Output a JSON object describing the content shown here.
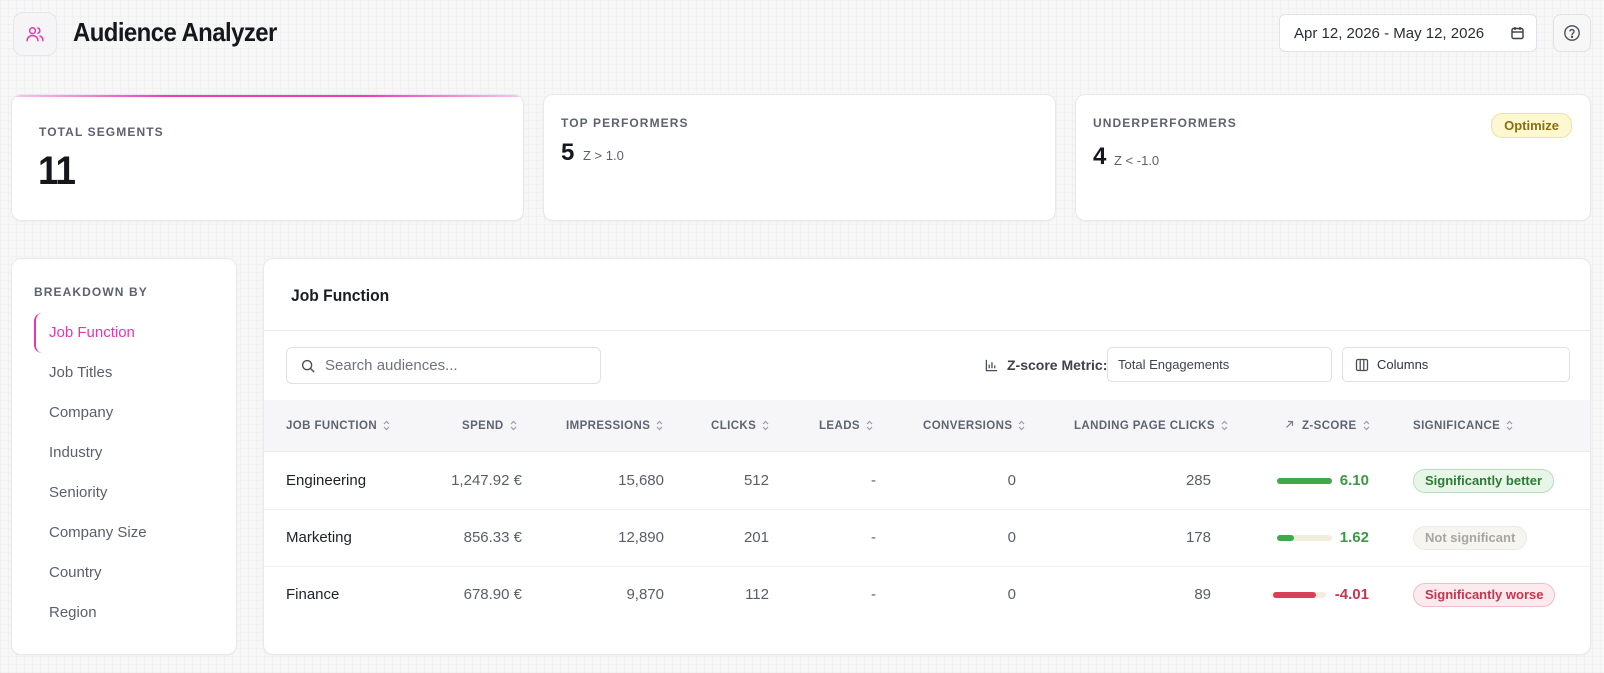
{
  "header": {
    "title": "Audience Analyzer",
    "date_range": "Apr 12, 2026 - May 12, 2026"
  },
  "stats": {
    "total_segments": {
      "label": "TOTAL SEGMENTS",
      "value": "11"
    },
    "top_performers": {
      "label": "TOP PERFORMERS",
      "value": "5",
      "note": "Z > 1.0"
    },
    "underperformers": {
      "label": "UNDERPERFORMERS",
      "value": "4",
      "note": "Z < -1.0",
      "badge": "Optimize"
    }
  },
  "sidebar": {
    "title": "BREAKDOWN BY",
    "items": [
      {
        "label": "Job Function"
      },
      {
        "label": "Job Titles"
      },
      {
        "label": "Company"
      },
      {
        "label": "Industry"
      },
      {
        "label": "Seniority"
      },
      {
        "label": "Company Size"
      },
      {
        "label": "Country"
      },
      {
        "label": "Region"
      }
    ],
    "active_index": 0
  },
  "panel": {
    "title": "Job Function",
    "search_placeholder": "Search audiences...",
    "zscore_metric_label": "Z-score Metric:",
    "zscore_metric_value": "Total Engagements",
    "columns_label": "Columns"
  },
  "table": {
    "headers": {
      "job_function": "JOB FUNCTION",
      "spend": "SPEND",
      "impressions": "IMPRESSIONS",
      "clicks": "CLICKS",
      "leads": "LEADS",
      "conversions": "CONVERSIONS",
      "landing_page_clicks": "LANDING PAGE CLICKS",
      "zscore": "Z-SCORE",
      "significance": "SIGNIFICANCE"
    },
    "rows": [
      {
        "name": "Engineering",
        "spend": "1,247.92 €",
        "impressions": "15,680",
        "clicks": "512",
        "leads": "-",
        "conversions": "0",
        "lp_clicks": "285",
        "zscore": "6.10",
        "z_fill": 1.0,
        "z_dir": "pos",
        "significance": "Significantly better",
        "sig_type": "better"
      },
      {
        "name": "Marketing",
        "spend": "856.33 €",
        "impressions": "12,890",
        "clicks": "201",
        "leads": "-",
        "conversions": "0",
        "lp_clicks": "178",
        "zscore": "1.62",
        "z_fill": 0.3,
        "z_dir": "pos",
        "significance": "Not significant",
        "sig_type": "none"
      },
      {
        "name": "Finance",
        "spend": "678.90 €",
        "impressions": "9,870",
        "clicks": "112",
        "leads": "-",
        "conversions": "0",
        "lp_clicks": "89",
        "zscore": "-4.01",
        "z_fill": 0.78,
        "z_dir": "neg",
        "significance": "Significantly worse",
        "sig_type": "worse"
      }
    ]
  },
  "colors": {
    "accent": "#e637ad",
    "positive": "#3fa84a",
    "negative": "#d8405a",
    "zpos_text": "#3a9a44",
    "zneg_text": "#c8344c"
  }
}
